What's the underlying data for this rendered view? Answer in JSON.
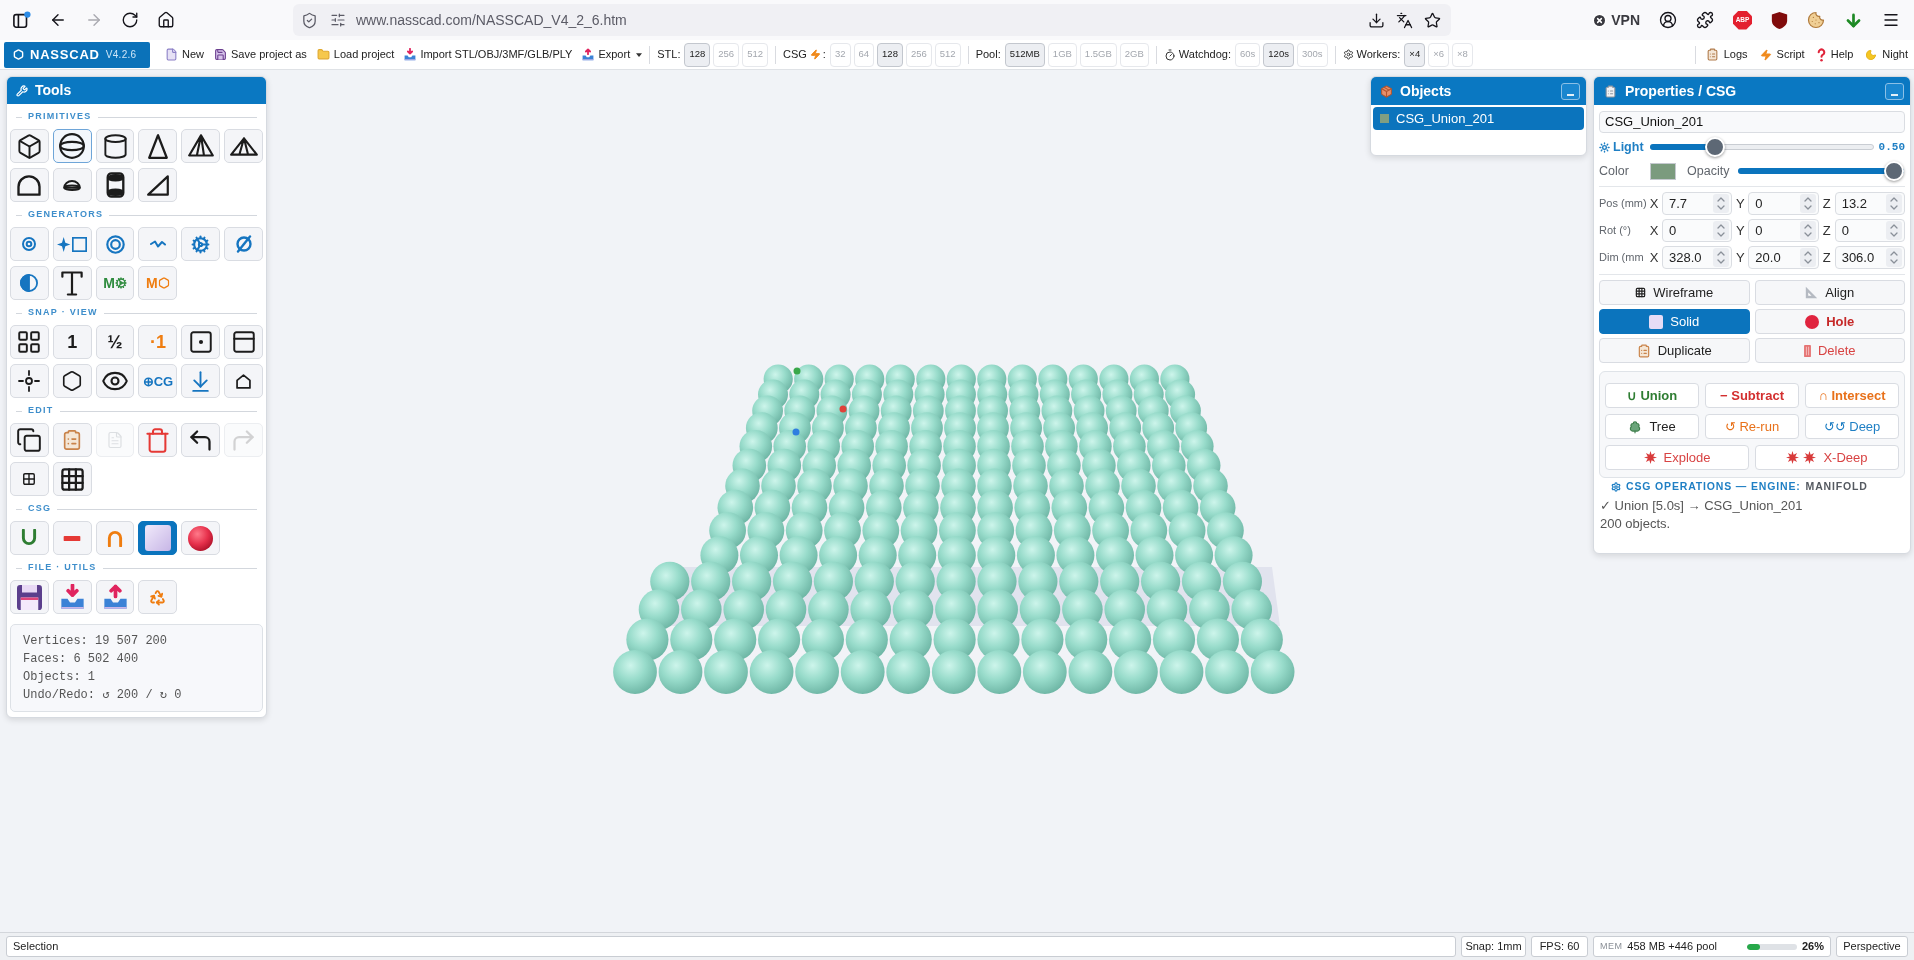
{
  "browser": {
    "url": "www.nasscad.com/NASSCAD_V4_2_6.htm",
    "vpn": "VPN",
    "abp": "ABP"
  },
  "toolbar": {
    "logo": "NASSCAD",
    "version": "V4.2.6",
    "menu": [
      {
        "label": "New",
        "dropdown": false
      },
      {
        "label": "Save project as",
        "dropdown": false
      },
      {
        "label": "Load project",
        "dropdown": false
      },
      {
        "label": "Import STL/OBJ/3MF/GLB/PLY",
        "dropdown": false
      },
      {
        "label": "Export",
        "dropdown": true
      }
    ],
    "option_groups": [
      {
        "label": "STL:",
        "options": [
          {
            "label": "128",
            "selected": true
          },
          {
            "label": "256",
            "selected": false
          },
          {
            "label": "512",
            "selected": false
          }
        ]
      },
      {
        "label": "CSG",
        "suffix": ":",
        "options": [
          {
            "label": "32",
            "selected": false
          },
          {
            "label": "64",
            "selected": false
          },
          {
            "label": "128",
            "selected": true
          },
          {
            "label": "256",
            "selected": false
          },
          {
            "label": "512",
            "selected": false
          }
        ]
      },
      {
        "label": "Pool:",
        "options": [
          {
            "label": "512MB",
            "selected": true
          },
          {
            "label": "1GB",
            "selected": false
          },
          {
            "label": "1.5GB",
            "selected": false
          },
          {
            "label": "2GB",
            "selected": false
          }
        ]
      },
      {
        "label": "Watchdog:",
        "options": [
          {
            "label": "60s",
            "selected": false
          },
          {
            "label": "120s",
            "selected": true
          },
          {
            "label": "300s",
            "selected": false
          }
        ]
      },
      {
        "label": "Workers:",
        "options": [
          {
            "label": "×4",
            "selected": true
          },
          {
            "label": "×6",
            "selected": false
          },
          {
            "label": "×8",
            "selected": false
          }
        ]
      }
    ],
    "links": [
      {
        "label": "Logs"
      },
      {
        "label": "Script"
      },
      {
        "label": "Help"
      },
      {
        "label": "Night"
      }
    ]
  },
  "tools": {
    "title": "Tools",
    "sections": [
      {
        "label": "PRIMITIVES",
        "buttons": [
          {
            "selected": false,
            "disabled": false
          },
          {
            "selected": true,
            "disabled": false
          },
          {
            "selected": false,
            "disabled": false
          },
          {
            "selected": false,
            "disabled": false
          },
          {
            "selected": false,
            "disabled": false
          },
          {
            "selected": false,
            "disabled": false
          },
          {
            "selected": false,
            "disabled": false
          },
          {
            "selected": false,
            "disabled": false
          },
          {
            "selected": false,
            "disabled": false
          },
          {
            "selected": false,
            "disabled": false
          }
        ]
      },
      {
        "label": "GENERATORS",
        "buttons": [
          {
            "selected": false,
            "disabled": false
          },
          {
            "selected": false,
            "disabled": false
          },
          {
            "selected": false,
            "disabled": false
          },
          {
            "selected": false,
            "disabled": false
          },
          {
            "selected": false,
            "disabled": false
          },
          {
            "selected": false,
            "disabled": false
          },
          {
            "selected": false,
            "disabled": false
          },
          {
            "selected": false,
            "disabled": false
          },
          {
            "selected": false,
            "disabled": false,
            "glyph": "M",
            "color": "#2e8b3e"
          },
          {
            "selected": false,
            "disabled": false,
            "glyph": "M",
            "color": "#ef7d10"
          }
        ]
      },
      {
        "label": "SNAP · VIEW",
        "buttons": [
          {
            "selected": false,
            "disabled": false
          },
          {
            "selected": false,
            "disabled": false,
            "glyph": "1"
          },
          {
            "selected": false,
            "disabled": false,
            "glyph": "½"
          },
          {
            "selected": false,
            "disabled": false,
            "glyph": "·1",
            "color": "#ef7d10"
          },
          {
            "selected": false,
            "disabled": false
          },
          {
            "selected": false,
            "disabled": false
          },
          {
            "selected": false,
            "disabled": false
          },
          {
            "selected": false,
            "disabled": false
          },
          {
            "selected": false,
            "disabled": false
          },
          {
            "selected": false,
            "disabled": false,
            "glyph": "⊕CG",
            "color": "#1675c0"
          },
          {
            "selected": false,
            "disabled": false
          },
          {
            "selected": false,
            "disabled": false
          }
        ]
      },
      {
        "label": "EDIT",
        "buttons": [
          {
            "selected": false,
            "disabled": false
          },
          {
            "selected": false,
            "disabled": false
          },
          {
            "selected": false,
            "disabled": true
          },
          {
            "selected": false,
            "disabled": false
          },
          {
            "selected": false,
            "disabled": false
          },
          {
            "selected": false,
            "disabled": true
          },
          {
            "selected": false,
            "disabled": false
          },
          {
            "selected": false,
            "disabled": false
          }
        ]
      },
      {
        "label": "CSG",
        "buttons": [
          {
            "selected": false,
            "disabled": false
          },
          {
            "selected": false,
            "disabled": false
          },
          {
            "selected": false,
            "disabled": false
          },
          {
            "selected": true,
            "disabled": false
          },
          {
            "selected": false,
            "disabled": false
          }
        ]
      },
      {
        "label": "FILE · UTILS",
        "buttons": [
          {
            "selected": false,
            "disabled": false
          },
          {
            "selected": false,
            "disabled": false
          },
          {
            "selected": false,
            "disabled": false
          },
          {
            "selected": false,
            "disabled": false
          }
        ]
      }
    ],
    "stats": [
      "Vertices: 19 507 200",
      "Faces: 6 502 400",
      "Objects: 1",
      "Undo/Redo: ↺ 200 / ↻ 0"
    ]
  },
  "objects": {
    "title": "Objects",
    "items": [
      {
        "name": "CSG_Union_201",
        "selected": true,
        "color": "#7f9e82"
      }
    ]
  },
  "properties": {
    "title": "Properties / CSG",
    "name": "CSG_Union_201",
    "light": {
      "label": "Light",
      "level": 0.27,
      "reading": "0.50"
    },
    "color_picker": {
      "label": "Color",
      "color": "#7b9b7e"
    },
    "opacity": {
      "label": "Opacity",
      "level": 1
    },
    "transform": [
      {
        "label": "Pos (mm)",
        "fields": [
          {
            "axis": "X",
            "value": "7.7"
          },
          {
            "axis": "Y",
            "value": "0"
          },
          {
            "axis": "Z",
            "value": "13.2"
          }
        ]
      },
      {
        "label": "Rot (°)",
        "fields": [
          {
            "axis": "X",
            "value": "0"
          },
          {
            "axis": "Y",
            "value": "0"
          },
          {
            "axis": "Z",
            "value": "0"
          }
        ]
      },
      {
        "label": "Dim (mm",
        "fields": [
          {
            "axis": "X",
            "value": "328.0"
          },
          {
            "axis": "Y",
            "value": "20.0"
          },
          {
            "axis": "Z",
            "value": "306.0"
          }
        ]
      }
    ],
    "buttons": [
      {
        "label": "Wireframe",
        "selected": false
      },
      {
        "label": "Align",
        "selected": false
      },
      {
        "label": "Solid",
        "selected": true
      },
      {
        "label": "Hole",
        "selected": false,
        "color": "#c62828"
      },
      {
        "label": "Duplicate",
        "selected": false
      },
      {
        "label": "Delete",
        "selected": false,
        "color": "#d84343"
      }
    ],
    "csg": {
      "operations": [
        {
          "label": "∪ Union",
          "color": "#2e7d32"
        },
        {
          "label": "− Subtract",
          "color": "#d32f2f"
        },
        {
          "label": "∩ Intersect",
          "color": "#e8711a"
        }
      ],
      "actions": [
        {
          "label": "Tree"
        },
        {
          "label": "↺ Re-run",
          "color": "#e8711a"
        },
        {
          "label": "↺↺ Deep",
          "color": "#1f7fc4"
        }
      ],
      "explode": [
        {
          "label": "Explode",
          "color": "#d84343"
        },
        {
          "label": "X-Deep",
          "color": "#d84343"
        }
      ],
      "legend": "CSG OPERATIONS — ENGINE:",
      "engine": "MANIFOLD",
      "log": [
        "✓ Union [5.0s] → CSG_Union_201",
        "200 objects."
      ]
    }
  },
  "status_bar": {
    "mode": "Selection",
    "snap": "Snap: 1mm",
    "fps": "FPS: 60",
    "memory": {
      "label": "MEM",
      "value": "458 MB +446 pool",
      "level": 0.26,
      "percent": "26%"
    },
    "camera": "Perspective"
  }
}
